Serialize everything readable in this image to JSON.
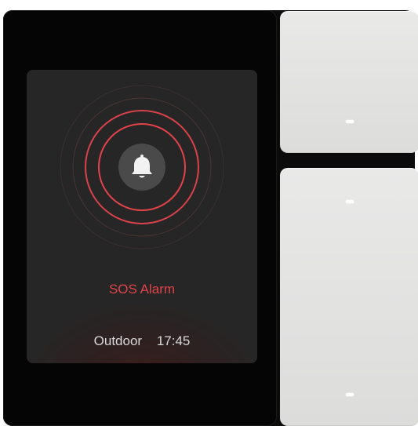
{
  "alarm": {
    "title": "SOS Alarm",
    "icon": "bell-icon",
    "accent_color": "#e2434a"
  },
  "status": {
    "location": "Outdoor",
    "time": "17:45"
  },
  "rockers": {
    "top": {
      "indicator_count": 1
    },
    "bottom": {
      "indicator_count": 2
    }
  }
}
